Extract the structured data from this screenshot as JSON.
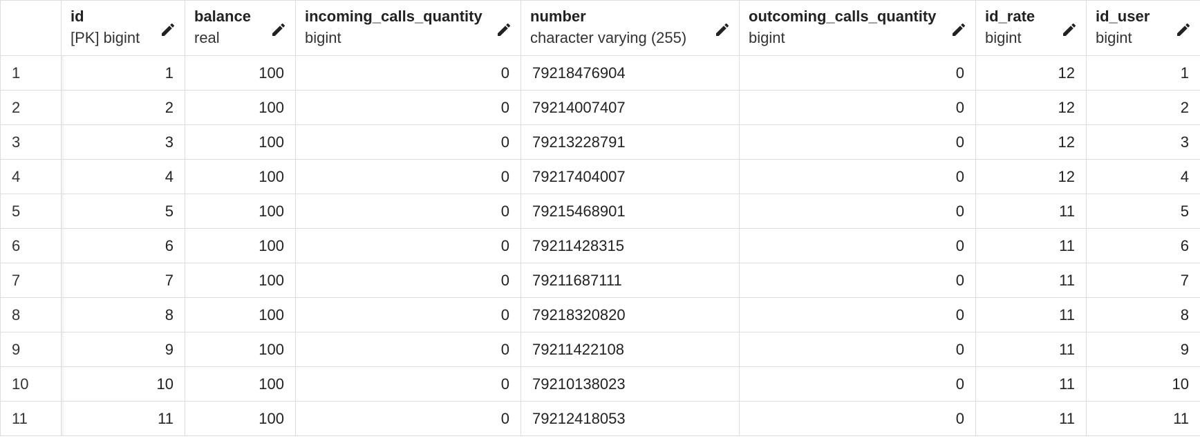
{
  "grid": {
    "columns": [
      {
        "name": "id",
        "type": "[PK] bigint"
      },
      {
        "name": "balance",
        "type": "real"
      },
      {
        "name": "incoming_calls_quantity",
        "type": "bigint"
      },
      {
        "name": "number",
        "type": "character varying (255)"
      },
      {
        "name": "outcoming_calls_quantity",
        "type": "bigint"
      },
      {
        "name": "id_rate",
        "type": "bigint"
      },
      {
        "name": "id_user",
        "type": "bigint"
      }
    ],
    "rows": [
      {
        "row": "1",
        "id": "1",
        "balance": "100",
        "incoming": "0",
        "number": "79218476904",
        "outcoming": "0",
        "id_rate": "12",
        "id_user": "1"
      },
      {
        "row": "2",
        "id": "2",
        "balance": "100",
        "incoming": "0",
        "number": "79214007407",
        "outcoming": "0",
        "id_rate": "12",
        "id_user": "2"
      },
      {
        "row": "3",
        "id": "3",
        "balance": "100",
        "incoming": "0",
        "number": "79213228791",
        "outcoming": "0",
        "id_rate": "12",
        "id_user": "3"
      },
      {
        "row": "4",
        "id": "4",
        "balance": "100",
        "incoming": "0",
        "number": "79217404007",
        "outcoming": "0",
        "id_rate": "12",
        "id_user": "4"
      },
      {
        "row": "5",
        "id": "5",
        "balance": "100",
        "incoming": "0",
        "number": "79215468901",
        "outcoming": "0",
        "id_rate": "11",
        "id_user": "5"
      },
      {
        "row": "6",
        "id": "6",
        "balance": "100",
        "incoming": "0",
        "number": "79211428315",
        "outcoming": "0",
        "id_rate": "11",
        "id_user": "6"
      },
      {
        "row": "7",
        "id": "7",
        "balance": "100",
        "incoming": "0",
        "number": "79211687111",
        "outcoming": "0",
        "id_rate": "11",
        "id_user": "7"
      },
      {
        "row": "8",
        "id": "8",
        "balance": "100",
        "incoming": "0",
        "number": "79218320820",
        "outcoming": "0",
        "id_rate": "11",
        "id_user": "8"
      },
      {
        "row": "9",
        "id": "9",
        "balance": "100",
        "incoming": "0",
        "number": "79211422108",
        "outcoming": "0",
        "id_rate": "11",
        "id_user": "9"
      },
      {
        "row": "10",
        "id": "10",
        "balance": "100",
        "incoming": "0",
        "number": "79210138023",
        "outcoming": "0",
        "id_rate": "11",
        "id_user": "10"
      },
      {
        "row": "11",
        "id": "11",
        "balance": "100",
        "incoming": "0",
        "number": "79212418053",
        "outcoming": "0",
        "id_rate": "11",
        "id_user": "11"
      }
    ]
  },
  "icons": {
    "edit": "pencil-icon"
  },
  "colors": {
    "border": "#dddddd",
    "text": "#222222",
    "background": "#ffffff"
  }
}
